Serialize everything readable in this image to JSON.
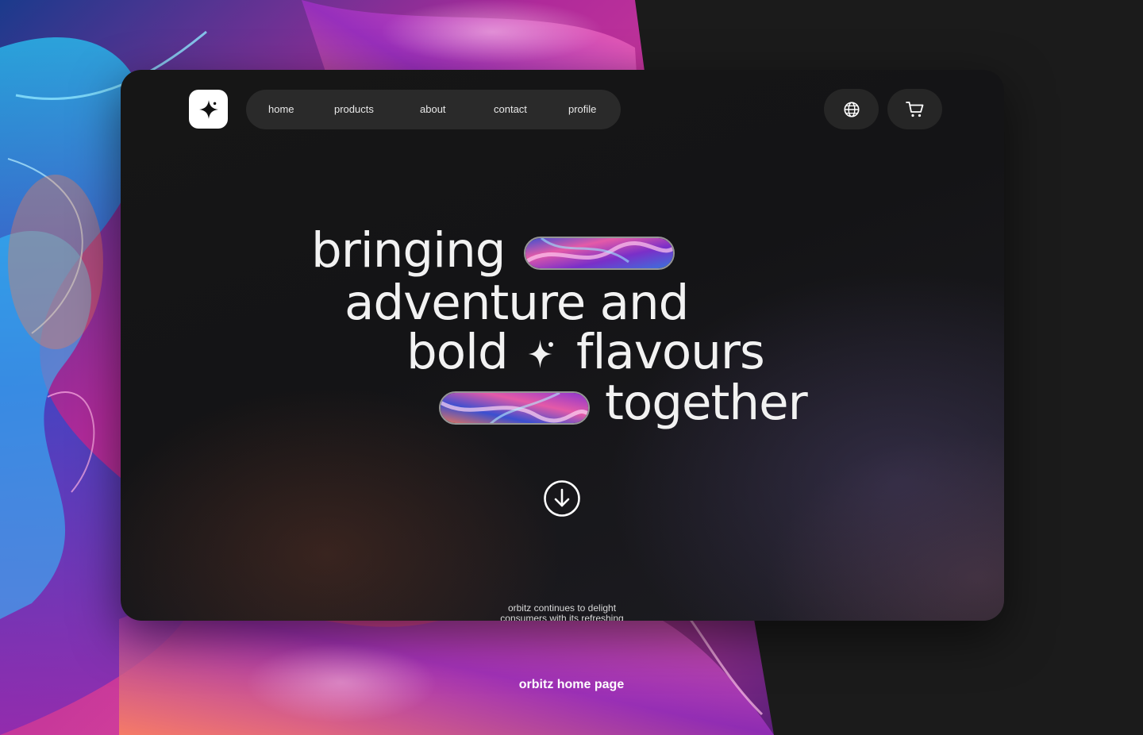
{
  "nav": {
    "items": [
      {
        "label": "home"
      },
      {
        "label": "products"
      },
      {
        "label": "about"
      },
      {
        "label": "contact"
      },
      {
        "label": "profile"
      }
    ]
  },
  "hero": {
    "line1": "bringing",
    "line2": "adventure  and",
    "line3_a": "bold",
    "line3_b": "flavours",
    "line4": "together"
  },
  "tagline": {
    "line1": "orbitz continues to delight",
    "line2": "consumers with its refreshing"
  },
  "caption": "orbitz home page",
  "colors": {
    "accent_magenta": "#d23cb4",
    "accent_blue": "#3a7bd8",
    "card_bg": "#141414",
    "nav_bg": "#2a2a2a"
  },
  "icons": {
    "logo": "sparkle-icon",
    "language": "globe-icon",
    "cart": "cart-icon",
    "scroll": "arrow-down-circle-icon",
    "hero_divider": "sparkle-icon"
  }
}
